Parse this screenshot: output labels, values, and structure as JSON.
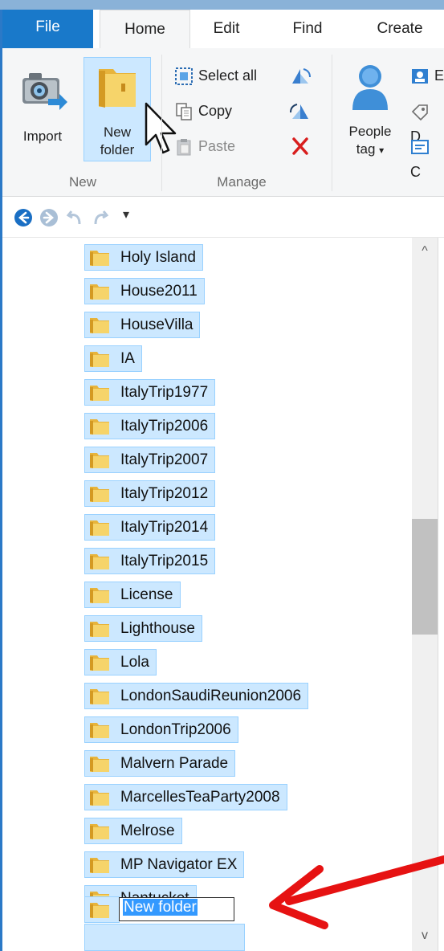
{
  "tabs": {
    "file": "File",
    "home": "Home",
    "edit": "Edit",
    "find": "Find",
    "create": "Create"
  },
  "ribbon": {
    "import_label": "Import",
    "new_folder_line1": "New",
    "new_folder_line2": "folder",
    "select_all": "Select all",
    "copy": "Copy",
    "paste": "Paste",
    "people_tag_line1": "People",
    "people_tag_line2": "tag",
    "dropdown_glyph": "▾",
    "group_new": "New",
    "group_manage": "Manage",
    "clipped_b": "E",
    "clipped_d": "D",
    "clipped_c": "C"
  },
  "qat": {
    "more_glyph": "▾"
  },
  "folders": [
    "Holy Island",
    "House2011",
    "HouseVilla",
    "IA",
    "ItalyTrip1977",
    "ItalyTrip2006",
    "ItalyTrip2007",
    "ItalyTrip2012",
    "ItalyTrip2014",
    "ItalyTrip2015",
    "License",
    "Lighthouse",
    "Lola",
    "LondonSaudiReunion2006",
    "LondonTrip2006",
    "Malvern Parade",
    "MarcellesTeaParty2008",
    "Melrose",
    "MP Navigator EX",
    "Nantucket"
  ],
  "rename": {
    "value": "New folder"
  },
  "scrollbar": {
    "up_glyph": "^",
    "down_glyph": "v"
  },
  "colors": {
    "accent": "#1979ca",
    "selection": "#cce8ff",
    "selection_border": "#99d1ff",
    "arrow": "#e61212"
  },
  "icons": {
    "import": "camera-import-icon",
    "new_folder": "folder-icon",
    "select_all": "select-all-icon",
    "copy": "copy-icon",
    "paste": "paste-icon",
    "rotate_left": "rotate-left-icon",
    "rotate_right": "rotate-right-icon",
    "delete": "delete-x-icon",
    "people_tag": "person-icon",
    "back": "back-arrow-icon",
    "forward": "forward-arrow-icon",
    "undo": "undo-icon",
    "redo": "redo-icon",
    "cursor": "mouse-pointer-icon"
  }
}
